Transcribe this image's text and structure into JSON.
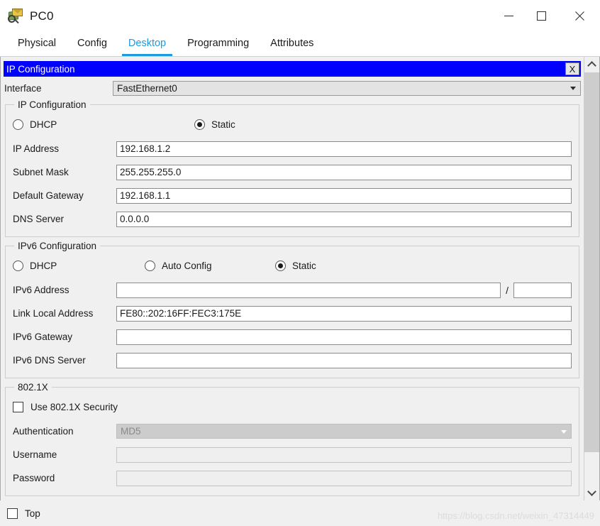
{
  "window": {
    "title": "PC0",
    "icon": "pc-magnifier-icon",
    "minimize_label": "—",
    "maximize_label": "□",
    "close_label": "✕"
  },
  "tabs": [
    {
      "label": "Physical",
      "active": false
    },
    {
      "label": "Config",
      "active": false
    },
    {
      "label": "Desktop",
      "active": true
    },
    {
      "label": "Programming",
      "active": false
    },
    {
      "label": "Attributes",
      "active": false
    }
  ],
  "dialog": {
    "header_title": "IP Configuration",
    "close_button_label": "X",
    "header_bg": "#0000FF",
    "header_fg": "#FFFFFF"
  },
  "interface": {
    "label": "Interface",
    "value": "FastEthernet0"
  },
  "ipv4": {
    "group_title": "IP Configuration",
    "mode_dhcp_label": "DHCP",
    "mode_dhcp_selected": false,
    "mode_static_label": "Static",
    "mode_static_selected": true,
    "fields": [
      {
        "label": "IP Address",
        "value": "192.168.1.2"
      },
      {
        "label": "Subnet Mask",
        "value": "255.255.255.0"
      },
      {
        "label": "Default Gateway",
        "value": "192.168.1.1"
      },
      {
        "label": "DNS Server",
        "value": "0.0.0.0"
      }
    ]
  },
  "ipv6": {
    "group_title": "IPv6 Configuration",
    "mode_dhcp_label": "DHCP",
    "mode_dhcp_selected": false,
    "mode_auto_label": "Auto Config",
    "mode_auto_selected": false,
    "mode_static_label": "Static",
    "mode_static_selected": true,
    "address_label": "IPv6 Address",
    "address_value": "",
    "prefix_separator": "/",
    "prefix_value": "",
    "fields": [
      {
        "label": "Link Local Address",
        "value": "FE80::202:16FF:FEC3:175E"
      },
      {
        "label": "IPv6 Gateway",
        "value": ""
      },
      {
        "label": "IPv6 DNS Server",
        "value": ""
      }
    ]
  },
  "dot1x": {
    "group_title": "802.1X",
    "use_security_label": "Use 802.1X Security",
    "use_security_checked": false,
    "authentication_label": "Authentication",
    "authentication_value": "MD5",
    "username_label": "Username",
    "username_value": "",
    "password_label": "Password",
    "password_value": ""
  },
  "bottom": {
    "top_checkbox_label": "Top",
    "top_checkbox_checked": false,
    "watermark": "https://blog.csdn.net/weixin_47314449"
  },
  "scrollbar": {
    "up_arrow": "scroll-up",
    "down_arrow": "scroll-down"
  }
}
